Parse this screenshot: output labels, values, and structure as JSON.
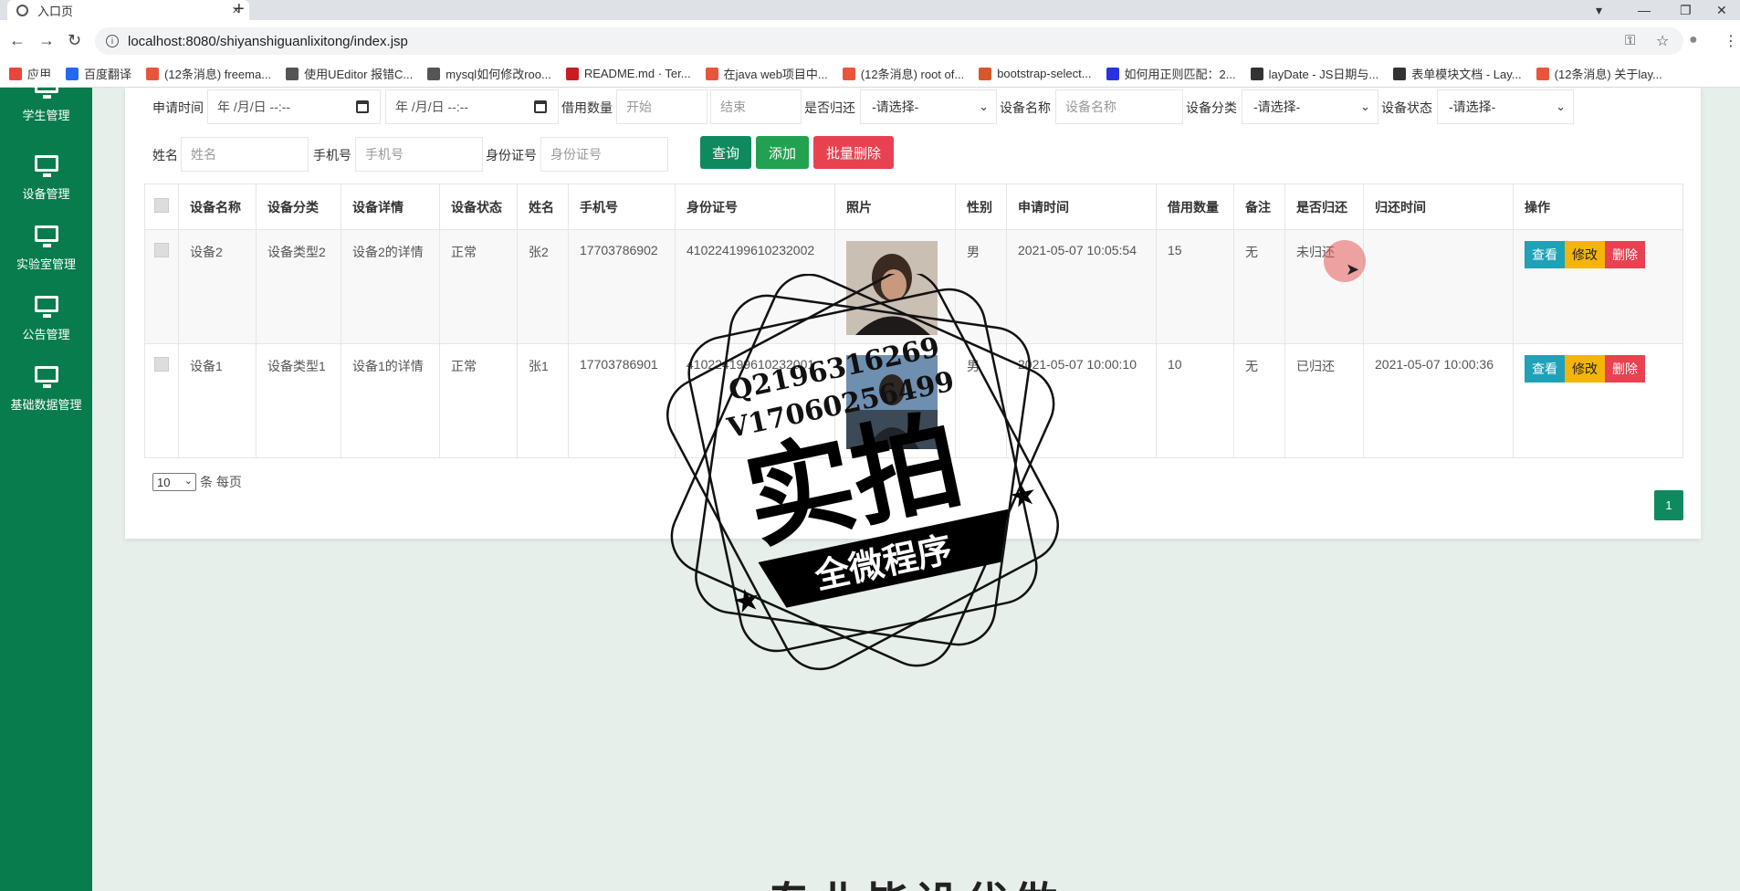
{
  "browser": {
    "tab_title": "入口页",
    "tab_close": "×",
    "new_tab": "+",
    "window_controls": [
      "▾",
      "—",
      "❐",
      "✕"
    ],
    "nav": [
      "←",
      "→",
      "↻"
    ],
    "url": "localhost:8080/shiyanshiguanlixitong/index.jsp",
    "info_glyph": "i",
    "right_icons": [
      "⚿",
      "☆",
      "●",
      "⋮"
    ],
    "bookmarks": [
      {
        "label": "应用",
        "color": "#e8453c"
      },
      {
        "label": "百度翻译",
        "color": "#2468f2"
      },
      {
        "label": "(12条消息) freema...",
        "color": "#e8553c"
      },
      {
        "label": "使用UEditor 报错C...",
        "color": "#555555"
      },
      {
        "label": "mysql如何修改roo...",
        "color": "#555555"
      },
      {
        "label": "README.md · Ter...",
        "color": "#c71d23"
      },
      {
        "label": "在java web项目中...",
        "color": "#e8553c"
      },
      {
        "label": "(12条消息) root of...",
        "color": "#e8553c"
      },
      {
        "label": "bootstrap-select...",
        "color": "#d8572a"
      },
      {
        "label": "如何用正则匹配：2...",
        "color": "#2932e1"
      },
      {
        "label": "layDate - JS日期与...",
        "color": "#333333"
      },
      {
        "label": "表单模块文档 - Lay...",
        "color": "#333333"
      },
      {
        "label": "(12条消息) 关于lay...",
        "color": "#e8553c"
      }
    ]
  },
  "sidebar": {
    "items": [
      {
        "label": "学生管理",
        "icon": "monitor-icon"
      },
      {
        "label": "设备管理",
        "icon": "monitor-icon"
      },
      {
        "label": "实验室管理",
        "icon": "monitor-icon"
      },
      {
        "label": "公告管理",
        "icon": "monitor-icon"
      },
      {
        "label": "基础数据管理",
        "icon": "monitor-icon"
      }
    ]
  },
  "filters": {
    "apply_time_label": "申请时间",
    "date_placeholder": "年 /月/日 --:--",
    "borrow_qty_label": "借用数量",
    "qty_start_placeholder": "开始",
    "qty_end_placeholder": "结束",
    "returned_label": "是否归还",
    "select_placeholder": "-请选择-",
    "device_name_label": "设备名称",
    "device_name_placeholder": "设备名称",
    "device_type_label": "设备分类",
    "device_status_label": "设备状态",
    "name_label": "姓名",
    "name_placeholder": "姓名",
    "phone_label": "手机号",
    "phone_placeholder": "手机号",
    "idcard_label": "身份证号",
    "idcard_placeholder": "身份证号",
    "search_button": "查询",
    "add_button": "添加",
    "batch_delete_button": "批量删除"
  },
  "table": {
    "headers": [
      "设备名称",
      "设备分类",
      "设备详情",
      "设备状态",
      "姓名",
      "手机号",
      "身份证号",
      "照片",
      "性别",
      "申请时间",
      "借用数量",
      "备注",
      "是否归还",
      "归还时间",
      "操作"
    ],
    "rows": [
      {
        "device_name": "设备2",
        "device_type": "设备类型2",
        "detail": "设备2的详情",
        "status": "正常",
        "name": "张2",
        "phone": "17703786902",
        "idcard": "410224199610232002",
        "gender": "男",
        "apply_time": "2021-05-07 10:05:54",
        "qty": "15",
        "remark": "无",
        "returned": "未归还",
        "return_time": ""
      },
      {
        "device_name": "设备1",
        "device_type": "设备类型1",
        "detail": "设备1的详情",
        "status": "正常",
        "name": "张1",
        "phone": "17703786901",
        "idcard": "410224199610232001",
        "gender": "男",
        "apply_time": "2021-05-07 10:00:10",
        "qty": "10",
        "remark": "无",
        "returned": "已归还",
        "return_time": "2021-05-07 10:00:36"
      }
    ],
    "op_view": "查看",
    "op_edit": "修改",
    "op_delete": "删除"
  },
  "pagination": {
    "page_size": "10",
    "page_size_label": "条 每页",
    "current_page": "1"
  },
  "watermark": {
    "line1": "Q2196316269",
    "line2": "V17060256499",
    "big": "实拍",
    "ribbon": "全微程序"
  },
  "footer_title": "专业毕设代做",
  "colors": {
    "sidebar": "#087c4c",
    "search": "#0f8a5f",
    "add": "#22a150",
    "delete": "#e8414f",
    "view": "#1fa2b8",
    "edit": "#f5b40a"
  }
}
